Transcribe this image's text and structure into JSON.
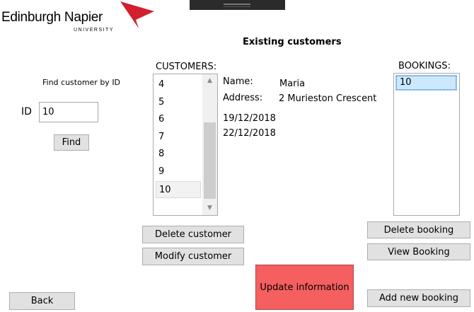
{
  "logo": {
    "name": "Edinburgh Napier",
    "sub": "UNIVERSITY"
  },
  "title": "Existing customers",
  "find": {
    "heading": "Find customer by ID",
    "id_label": "ID",
    "id_value": "10",
    "button": "Find"
  },
  "customers": {
    "label": "CUSTOMERS:",
    "items": [
      "4",
      "5",
      "6",
      "7",
      "8",
      "9",
      "10"
    ],
    "selected": "10"
  },
  "details": {
    "name_label": "Name:",
    "name_value": "Maria",
    "address_label": "Address:",
    "address_value": "2 Murieston Crescent",
    "dates": [
      "19/12/2018",
      "22/12/2018"
    ]
  },
  "bookings": {
    "label": "BOOKINGS:",
    "items": [
      "10"
    ]
  },
  "buttons": {
    "delete_customer": "Delete customer",
    "modify_customer": "Modify customer",
    "update_information": "Update information",
    "delete_booking": "Delete booking",
    "view_booking": "View Booking",
    "add_new_booking": "Add new booking",
    "back": "Back"
  },
  "icons": {
    "scroll_up": "▲",
    "scroll_down": "▼"
  },
  "colors": {
    "update_button": "#f55f5f",
    "logo_red": "#d3202f",
    "selection": "#cce8ff"
  }
}
